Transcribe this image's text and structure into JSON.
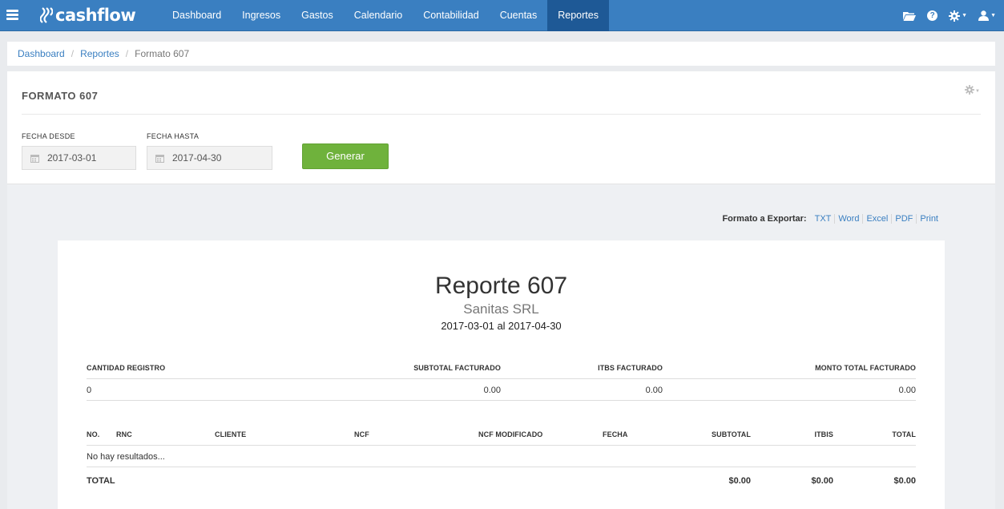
{
  "app": {
    "brand": "cashflow",
    "accent_color": "#3a7fc1",
    "active_nav_color": "#1e5996"
  },
  "nav": {
    "items": [
      {
        "label": "Dashboard"
      },
      {
        "label": "Ingresos"
      },
      {
        "label": "Gastos"
      },
      {
        "label": "Calendario"
      },
      {
        "label": "Contabilidad"
      },
      {
        "label": "Cuentas"
      },
      {
        "label": "Reportes",
        "active": true
      }
    ],
    "right_icons": [
      "folder-icon",
      "help-icon",
      "gear-icon",
      "user-icon"
    ]
  },
  "breadcrumb": {
    "items": [
      "Dashboard",
      "Reportes"
    ],
    "current": "Formato 607"
  },
  "form": {
    "title": "FORMATO 607",
    "fecha_desde_label": "FECHA DESDE",
    "fecha_desde_value": "2017-03-01",
    "fecha_hasta_label": "FECHA HASTA",
    "fecha_hasta_value": "2017-04-30",
    "generate_button": "Generar",
    "button_color": "#6fb23c"
  },
  "export": {
    "label": "Formato a Exportar:",
    "options": [
      "TXT",
      "Word",
      "Excel",
      "PDF",
      "Print"
    ]
  },
  "report": {
    "title": "Reporte 607",
    "company": "Sanitas SRL",
    "date_range": "2017-03-01 al 2017-04-30",
    "summary": {
      "headers": [
        "CANTIDAD REGISTRO",
        "SUBTOTAL FACTURADO",
        "ITBS FACTURADO",
        "MONTO TOTAL FACTURADO"
      ],
      "values": [
        "0",
        "0.00",
        "0.00",
        "0.00"
      ]
    },
    "detail": {
      "headers": [
        "NO.",
        "RNC",
        "CLIENTE",
        "NCF",
        "NCF MODIFICADO",
        "FECHA",
        "SUBTOTAL",
        "ITBIS",
        "TOTAL"
      ],
      "empty_message": "No hay resultados...",
      "total_label": "TOTAL",
      "totals": {
        "subtotal": "$0.00",
        "itbis": "$0.00",
        "total": "$0.00"
      }
    }
  }
}
